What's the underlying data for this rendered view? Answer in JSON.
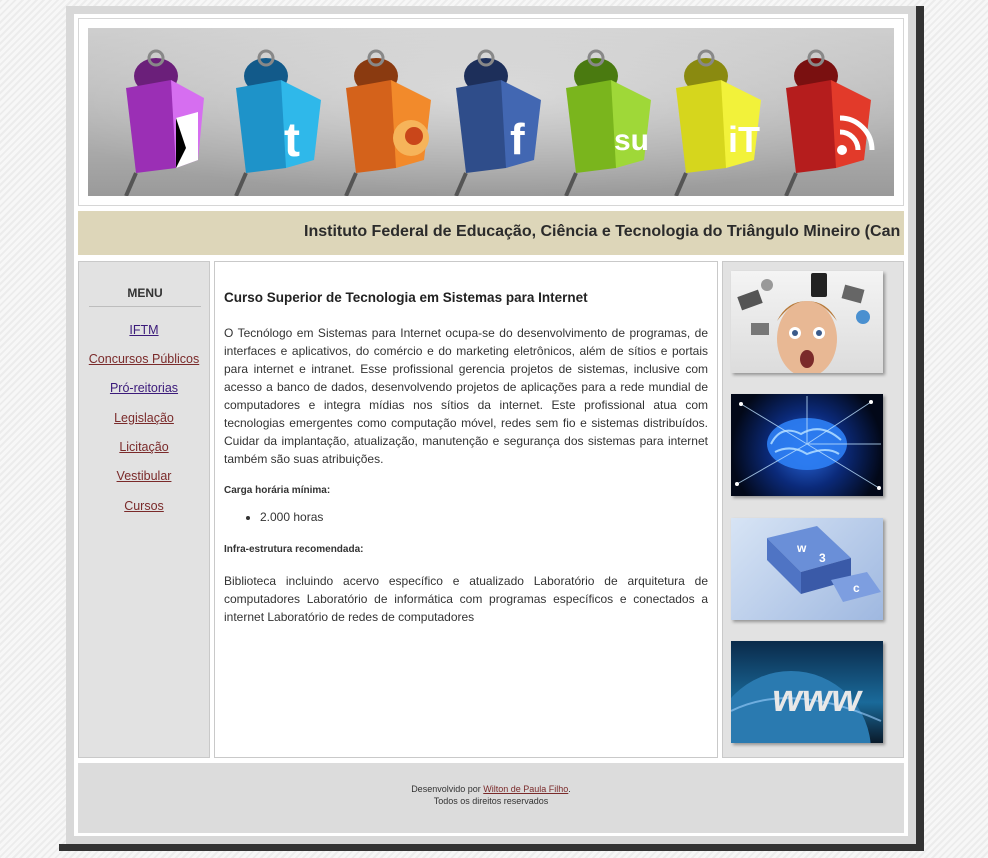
{
  "header": {
    "title": "Instituto Federal de Educação, Ciência e Tecnologia do Triângulo Mineiro (Can",
    "banner_icons": [
      "delicious-icon",
      "twitter-icon",
      "firefox-icon",
      "facebook-icon",
      "stumbleupon-icon",
      "technorati-icon",
      "rss-icon"
    ]
  },
  "menu": {
    "title": "MENU",
    "items": [
      {
        "label": "IFTM",
        "visited": true
      },
      {
        "label": "Concursos Públicos",
        "visited": false
      },
      {
        "label": "Pró-reitorias",
        "visited": true
      },
      {
        "label": "Legislação",
        "visited": false
      },
      {
        "label": "Licitação",
        "visited": false
      },
      {
        "label": "Vestibular",
        "visited": false
      },
      {
        "label": "Cursos",
        "visited": false
      }
    ]
  },
  "content": {
    "heading": "Curso Superior de Tecnologia em Sistemas para Internet",
    "description": "O Tecnólogo em Sistemas para Internet ocupa-se do desenvolvimento de programas, de interfaces e aplicativos, do comércio e do marketing eletrônicos, além de sítios e portais para internet e intranet. Esse profissional gerencia projetos de sistemas, inclusive com acesso a banco de dados, desenvolvendo projetos de aplicações para a rede mundial de computadores e integra mídias nos sítios da internet. Este profissional atua com tecnologias emergentes como computação móvel, redes sem fio e sistemas distribuídos. Cuidar da implantação, atualização, manutenção e segurança dos sistemas para internet também são suas atribuições.",
    "hours_label": "Carga horária mínima:",
    "hours_items": [
      "2.000 horas"
    ],
    "infra_label": "Infra-estrutura recomendada:",
    "infra_text": "Biblioteca incluindo acervo específico e atualizado Laboratório de arquitetura de computadores Laboratório de informática com programas específicos e conectados a internet Laboratório de redes de computadores"
  },
  "sidebar": {
    "images": [
      "surprised-man-gadgets-image",
      "glowing-brain-image",
      "w3c-keyboard-keys-image",
      "www-globe-image"
    ]
  },
  "footer": {
    "developed_by": "Desenvolvido por",
    "author": "Wilton de Paula Filho",
    "period": ".",
    "rights": "Todos os direitos reservados"
  },
  "colors": {
    "title_bar": "#ddd6b9",
    "link": "#7a2a2a",
    "visited_link": "#3b1a7a"
  }
}
